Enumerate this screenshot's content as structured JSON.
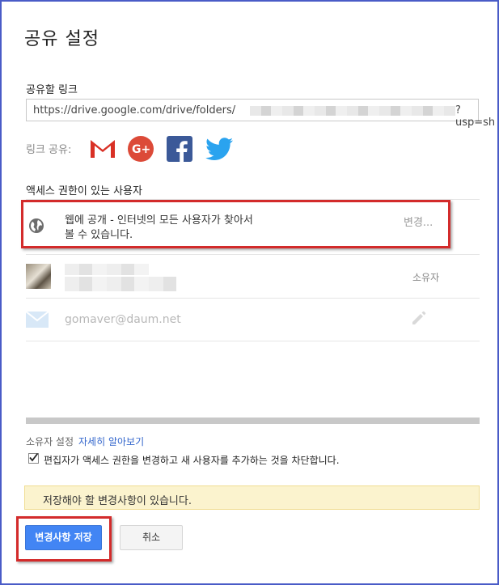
{
  "dialog": {
    "title": "공유 설정",
    "link_label": "공유할 링크",
    "link_prefix": "https://drive.google.com/drive/folders/",
    "link_suffix": "?usp=sh",
    "share_label": "링크 공유:",
    "share_icons": [
      "gmail-icon",
      "google-plus-icon",
      "facebook-icon",
      "twitter-icon"
    ],
    "access_label": "액세스 권한이 있는 사용자"
  },
  "access_rows": {
    "public": {
      "icon": "globe-icon",
      "line1": "웹에 공개 - 인터넷의 모든 사용자가 찾아서",
      "line2": "볼 수 있습니다.",
      "change_label": "변경..."
    },
    "owner": {
      "icon": "avatar",
      "role_label": "소유자"
    },
    "guest": {
      "icon": "mail-icon",
      "email": "gomaver@daum.net",
      "edit_icon": "pencil-icon"
    }
  },
  "owner_settings": {
    "label": "소유자 설정",
    "more_link": "자세히 알아보기",
    "checkbox_checked": true,
    "checkbox_label": "편집자가 액세스 권한을 변경하고 새 사용자를 추가하는 것을 차단합니다."
  },
  "notice": {
    "text": "저장해야 할 변경사항이 있습니다."
  },
  "buttons": {
    "save_label": "변경사항 저장",
    "cancel_label": "취소"
  },
  "colors": {
    "accent": "#4285f4",
    "highlight_border": "#d32b2b",
    "notice_bg": "#fbf3ce",
    "frame_border": "#4a5cc7"
  }
}
